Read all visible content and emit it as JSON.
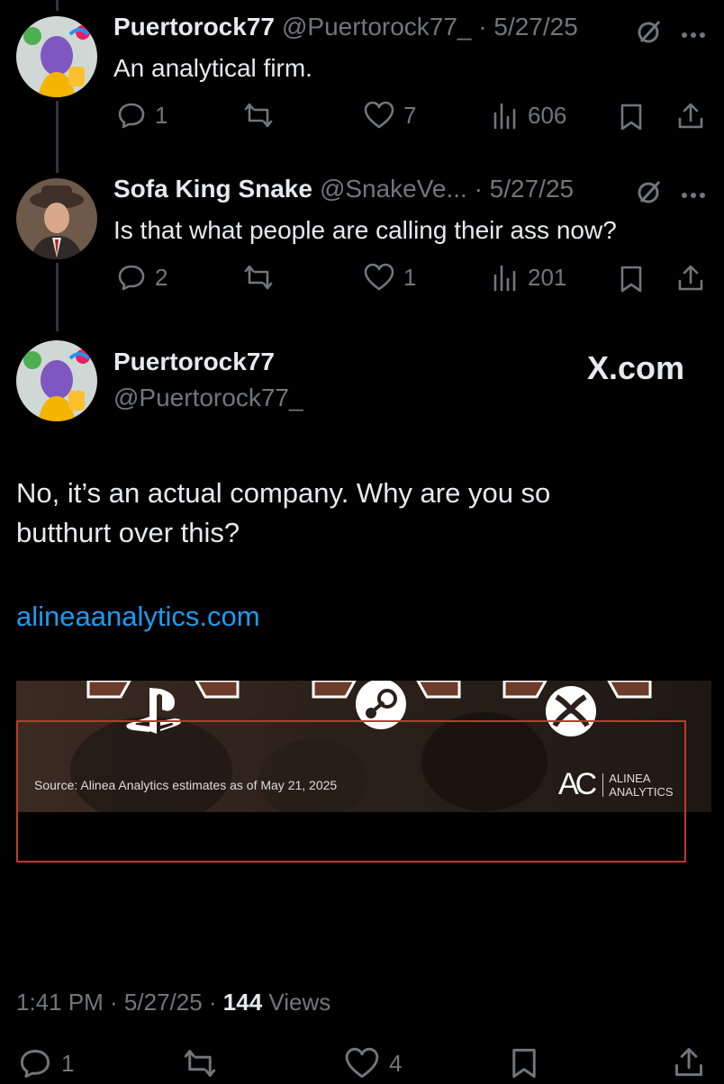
{
  "tweets": [
    {
      "name": "Puertorock77",
      "handle_date": "@Puertorock77_ · 5/27/25",
      "text": "An analytical firm.",
      "replies": "1",
      "likes": "7",
      "views": "606"
    },
    {
      "name": "Sofa King Snake",
      "handle_date": "@SnakeVe... · 5/27/25",
      "text": "Is that what people are calling their ass now?",
      "replies": "2",
      "likes": "1",
      "views": "201"
    }
  ],
  "main": {
    "name": "Puertorock77",
    "handle": "@Puertorock77_",
    "watermark": "X.com",
    "text_line1": "No, it’s an actual company. Why are you so",
    "text_line2": "butthurt over this?",
    "link": "alineaanalytics.com",
    "image": {
      "source": "Source: Alinea Analytics estimates as of May 21, 2025",
      "logo_mark": "AC",
      "logo_line1": "ALINEA",
      "logo_line2": "ANALYTICS",
      "highlight_color": "#c0392b"
    },
    "timestamp": "1:41 PM · 5/27/25 · ",
    "views_count": "144",
    "views_label": " Views",
    "replies": "1",
    "likes": "4"
  },
  "colors": {
    "background": "#000000",
    "text": "#e7e9ea",
    "muted": "#71767b",
    "link": "#1d9bf0"
  }
}
